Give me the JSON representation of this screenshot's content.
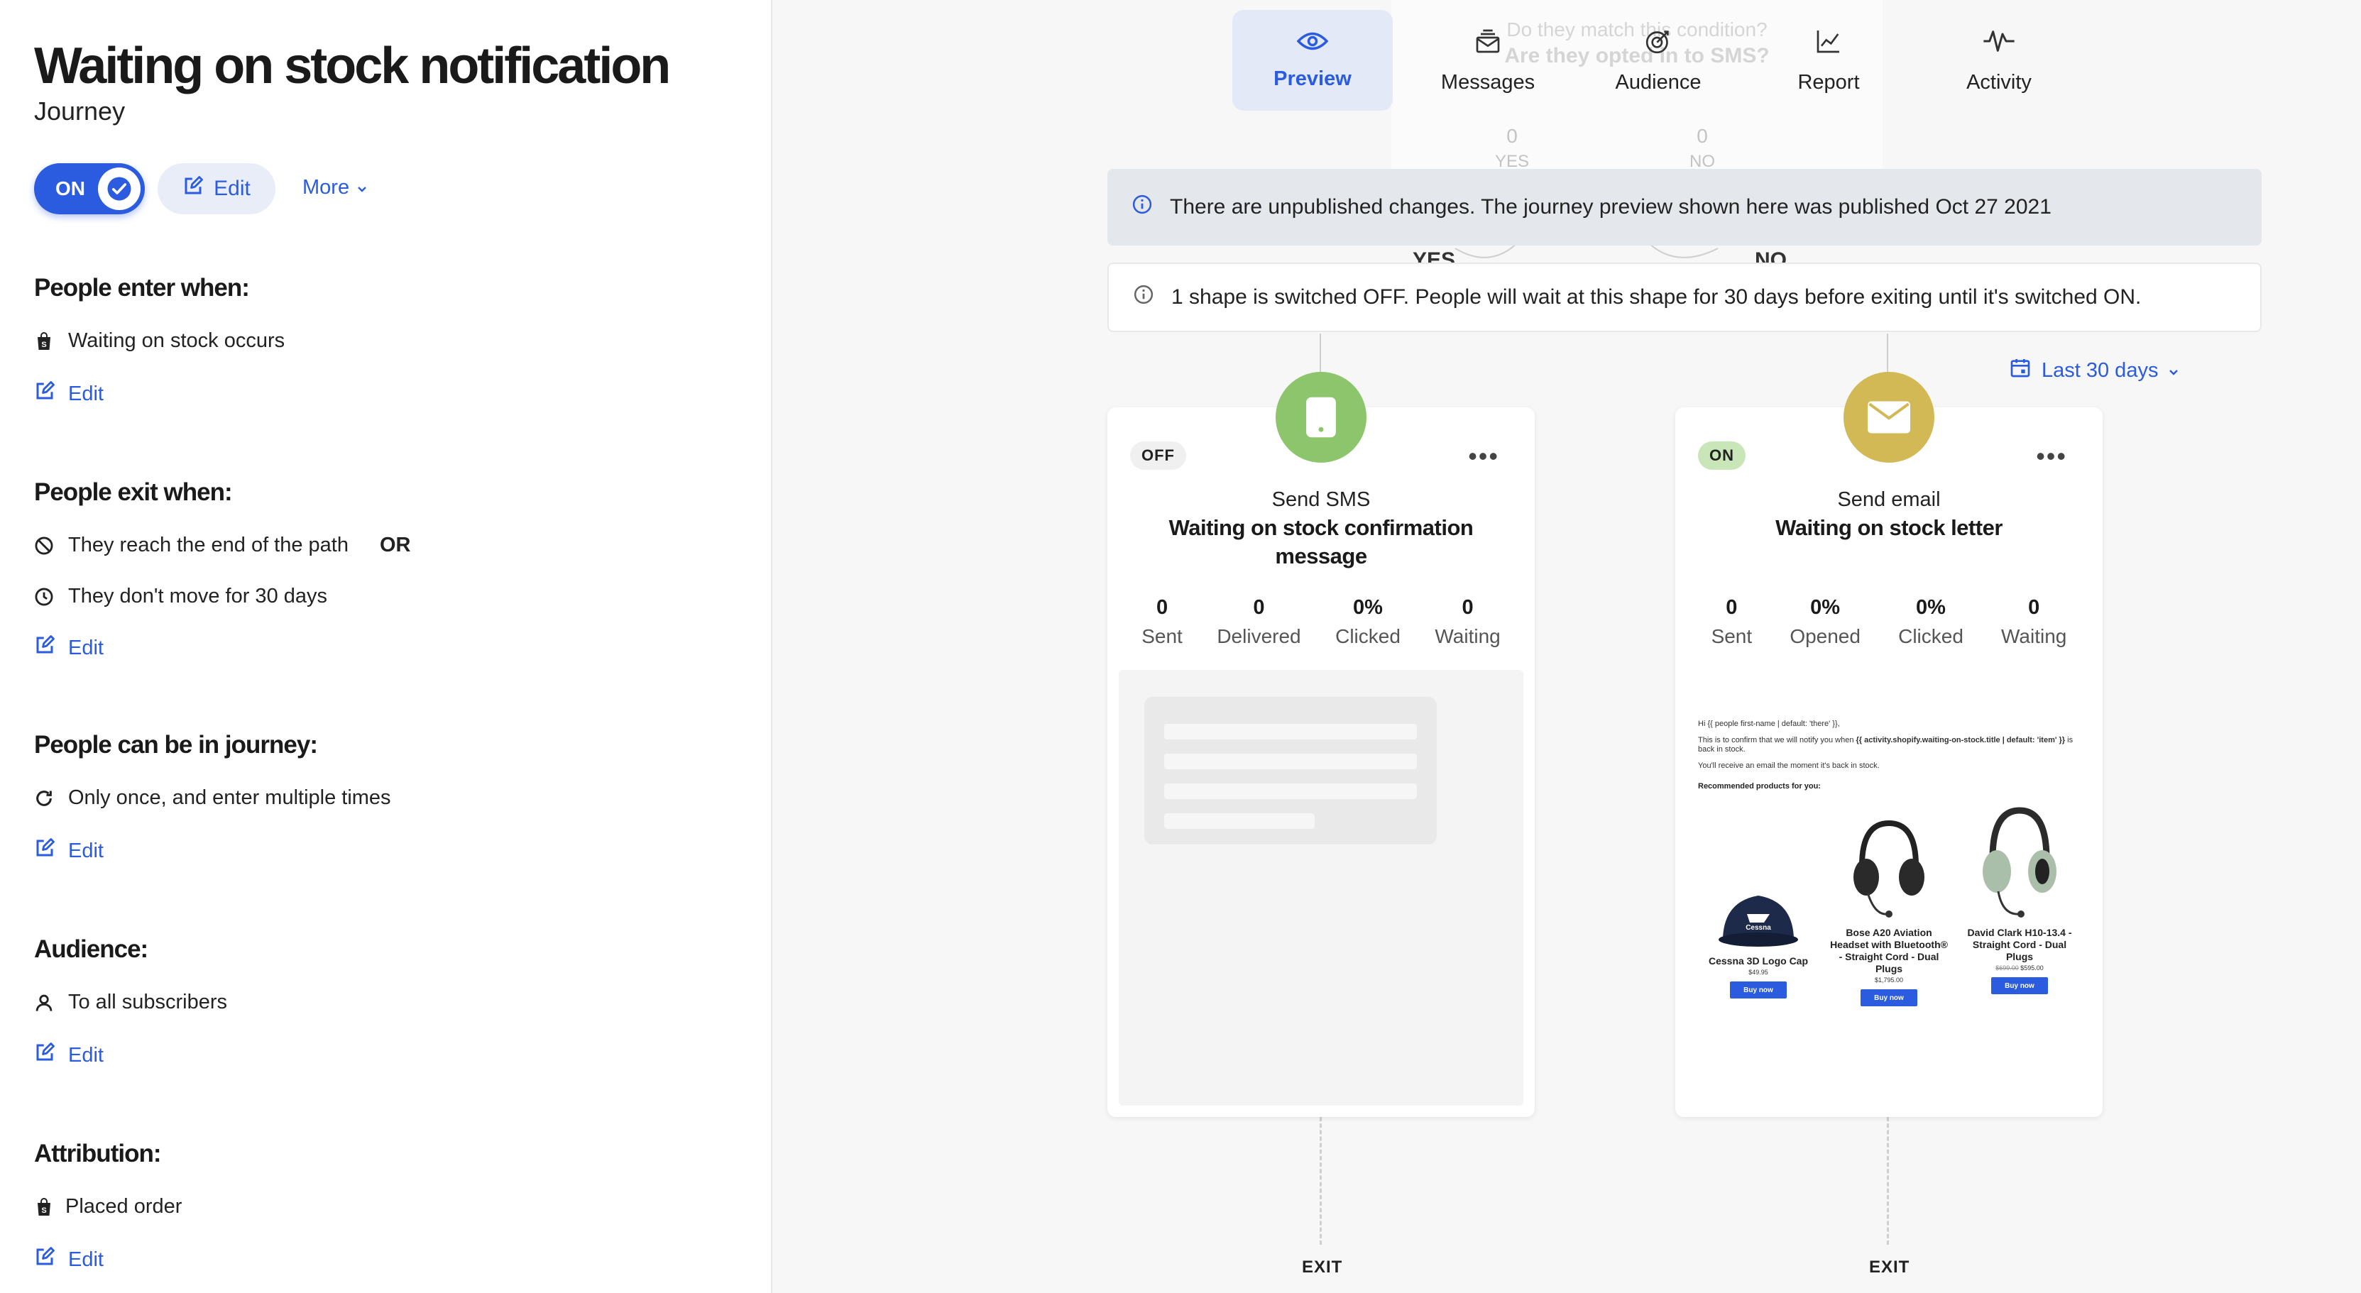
{
  "sidebar": {
    "title": "Waiting on stock notification",
    "subtitle": "Journey",
    "toggle_label": "ON",
    "edit_label": "Edit",
    "more_label": "More",
    "enter": {
      "heading": "People enter when:",
      "item": "Waiting on stock occurs",
      "edit": "Edit"
    },
    "exit": {
      "heading": "People exit when:",
      "item1": "They reach the end of the path",
      "or_label": "OR",
      "item2": "They don't move for 30 days",
      "edit": "Edit"
    },
    "in_journey": {
      "heading": "People can be in journey:",
      "item": "Only once, and enter multiple times",
      "edit": "Edit"
    },
    "audience": {
      "heading": "Audience:",
      "item": "To all subscribers",
      "edit": "Edit"
    },
    "attribution": {
      "heading": "Attribution:",
      "item": "Placed order",
      "edit": "Edit"
    }
  },
  "tabs": [
    {
      "label": "Preview",
      "icon": "eye-icon",
      "active": true
    },
    {
      "label": "Messages",
      "icon": "messages-icon",
      "active": false
    },
    {
      "label": "Audience",
      "icon": "target-icon",
      "active": false
    },
    {
      "label": "Report",
      "icon": "chart-icon",
      "active": false
    },
    {
      "label": "Activity",
      "icon": "activity-icon",
      "active": false
    }
  ],
  "ghost": {
    "question": "Do they match this condition?",
    "title": "Are they opted in to SMS?",
    "yes_count": "0",
    "yes_label": "YES",
    "no_count": "0",
    "no_label": "NO",
    "branch_yes": "YES",
    "branch_no": "NO"
  },
  "banners": {
    "unpublished": "There are unpublished changes. The journey preview shown here was published Oct 27 2021",
    "switched_off": "1 shape is switched OFF. People will wait at this shape for 30 days before exiting until it's switched ON."
  },
  "date_range": "Last 30 days",
  "cards": {
    "sms": {
      "status": "OFF",
      "type": "Send SMS",
      "name": "Waiting on stock confirmation message",
      "icon_color": "#8cc56c",
      "stats": [
        {
          "value": "0",
          "label": "Sent"
        },
        {
          "value": "0",
          "label": "Delivered"
        },
        {
          "value": "0%",
          "label": "Clicked"
        },
        {
          "value": "0",
          "label": "Waiting"
        }
      ]
    },
    "email": {
      "status": "ON",
      "type": "Send email",
      "name": "Waiting on stock letter",
      "icon_color": "#d2b955",
      "stats": [
        {
          "value": "0",
          "label": "Sent"
        },
        {
          "value": "0%",
          "label": "Opened"
        },
        {
          "value": "0%",
          "label": "Clicked"
        },
        {
          "value": "0",
          "label": "Waiting"
        }
      ],
      "preview": {
        "greeting": "Hi {{ people first-name | default: 'there' }},",
        "line1_a": "This is to confirm that we will notify you when ",
        "line1_b": "{{ activity.shopify.waiting-on-stock.title | default: 'item' }}",
        "line1_c": " is back in stock.",
        "line2": "You'll receive an email the moment it's back in stock.",
        "recommended": "Recommended products for you:",
        "products": [
          {
            "name": "Cessna 3D Logo Cap",
            "price": "$49.95",
            "old_price": "",
            "buy": "Buy now"
          },
          {
            "name": "Bose A20 Aviation Headset with Bluetooth® - Straight Cord - Dual Plugs",
            "price": "$1,795.00",
            "old_price": "",
            "buy": "Buy now"
          },
          {
            "name": "David Clark H10-13.4 - Straight Cord - Dual Plugs",
            "price": "$595.00",
            "old_price": "$699.00",
            "buy": "Buy now"
          }
        ]
      }
    }
  },
  "exit_label": "EXIT",
  "colors": {
    "accent": "#2b5bde",
    "tab_active_bg": "#e3e9f7",
    "banner_grey": "#e4e8ed"
  }
}
